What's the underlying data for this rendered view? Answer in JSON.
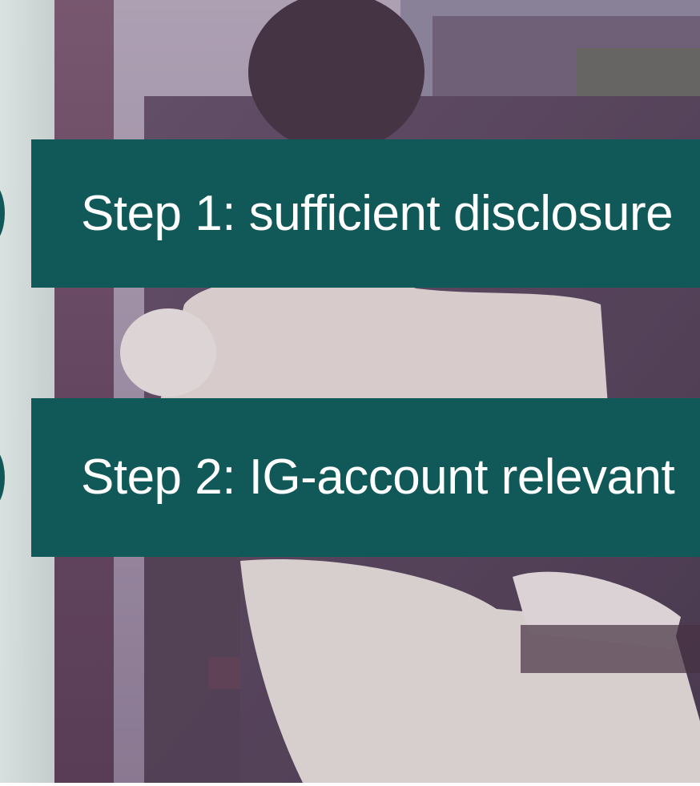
{
  "slide": {
    "steps": [
      {
        "label": "Step 1: sufficient disclosure"
      },
      {
        "label": "Step 2: IG-account relevant"
      }
    ]
  },
  "colors": {
    "banner": "#115958",
    "text": "#ffffff",
    "photo_tint": "#8a7a92"
  }
}
